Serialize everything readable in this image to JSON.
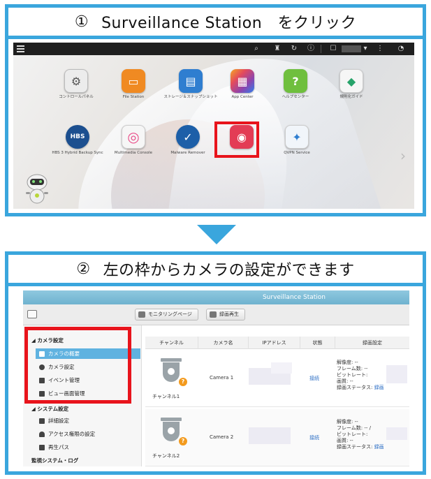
{
  "step1": {
    "number": "①",
    "title": "Surveillance Station　をクリック"
  },
  "step2": {
    "number": "②",
    "title": "左の枠からカメラの設定ができます"
  },
  "desktop": {
    "apps": [
      {
        "label": "コントロールパネル",
        "icon": "gear-icon",
        "color": "#6a6a6a",
        "glyph": "⚙"
      },
      {
        "label": "File Station",
        "icon": "folder-icon",
        "color": "#f08a22",
        "glyph": "▭"
      },
      {
        "label": "ストレージ＆スナップショット",
        "icon": "storage-icon",
        "color": "#2f7ed0",
        "glyph": "▤"
      },
      {
        "label": "App Center",
        "icon": "app-grid-icon",
        "color": "#e44b5c",
        "glyph": "▦"
      },
      {
        "label": "ヘルプセンター",
        "icon": "help-icon",
        "color": "#6fbf3e",
        "glyph": "?"
      },
      {
        "label": "規則化ガイド",
        "icon": "cube-icon",
        "color": "#27a36a",
        "glyph": "◆"
      },
      {
        "label": "HBS 3 Hybrid Backup Sync",
        "icon": "backup-icon",
        "color": "#1c4f8f",
        "glyph": "HBS"
      },
      {
        "label": "Multimedia Console",
        "icon": "multimedia-icon",
        "color": "#f3f3f3",
        "glyph": "◎"
      },
      {
        "label": "Malware Remover",
        "icon": "shield-icon",
        "color": "#1d5fa8",
        "glyph": "✓"
      },
      {
        "label": "Surveillance Station",
        "icon": "surveillance-icon",
        "color": "#e33c55",
        "glyph": "◉"
      },
      {
        "label": "QVPN Service",
        "icon": "vpn-icon",
        "color": "#f1f5fa",
        "glyph": "✦"
      }
    ]
  },
  "ss": {
    "window_title": "Surveillance Station",
    "monitor_btn": "モニタリングページ",
    "playback_btn": "録画再生",
    "sidebar": {
      "camera_settings": "カメラ設定",
      "items": [
        "カメラの概要",
        "カメラ設定",
        "イベント管理",
        "ビュー画面管理"
      ],
      "system_settings": "システム設定",
      "system_items": [
        "詳細設定",
        "アクセス権限の設定",
        "再生パス"
      ],
      "monitoring_log": "監視システム・ログ"
    },
    "table": {
      "headers": [
        "チャンネル",
        "カメラ名",
        "IPアドレス",
        "状態",
        "録画設定"
      ],
      "rows": [
        {
          "channel": "チャンネル1",
          "camera": "Camera 1",
          "status": "接続",
          "resolution": "解像度: --",
          "frames": "フレーム数: --",
          "bitrate": "ビットレート:",
          "quality": "画質: --",
          "rec_status": "録画ステータス: ",
          "rec_link": "録画"
        },
        {
          "channel": "チャンネル2",
          "camera": "Camera 2",
          "status": "接続",
          "resolution": "解像度: --",
          "frames": "フレーム数: -- /",
          "bitrate": "ビットレート:",
          "quality": "画質: --",
          "rec_status": "録画ステータス: ",
          "rec_link": "録画"
        }
      ]
    }
  }
}
